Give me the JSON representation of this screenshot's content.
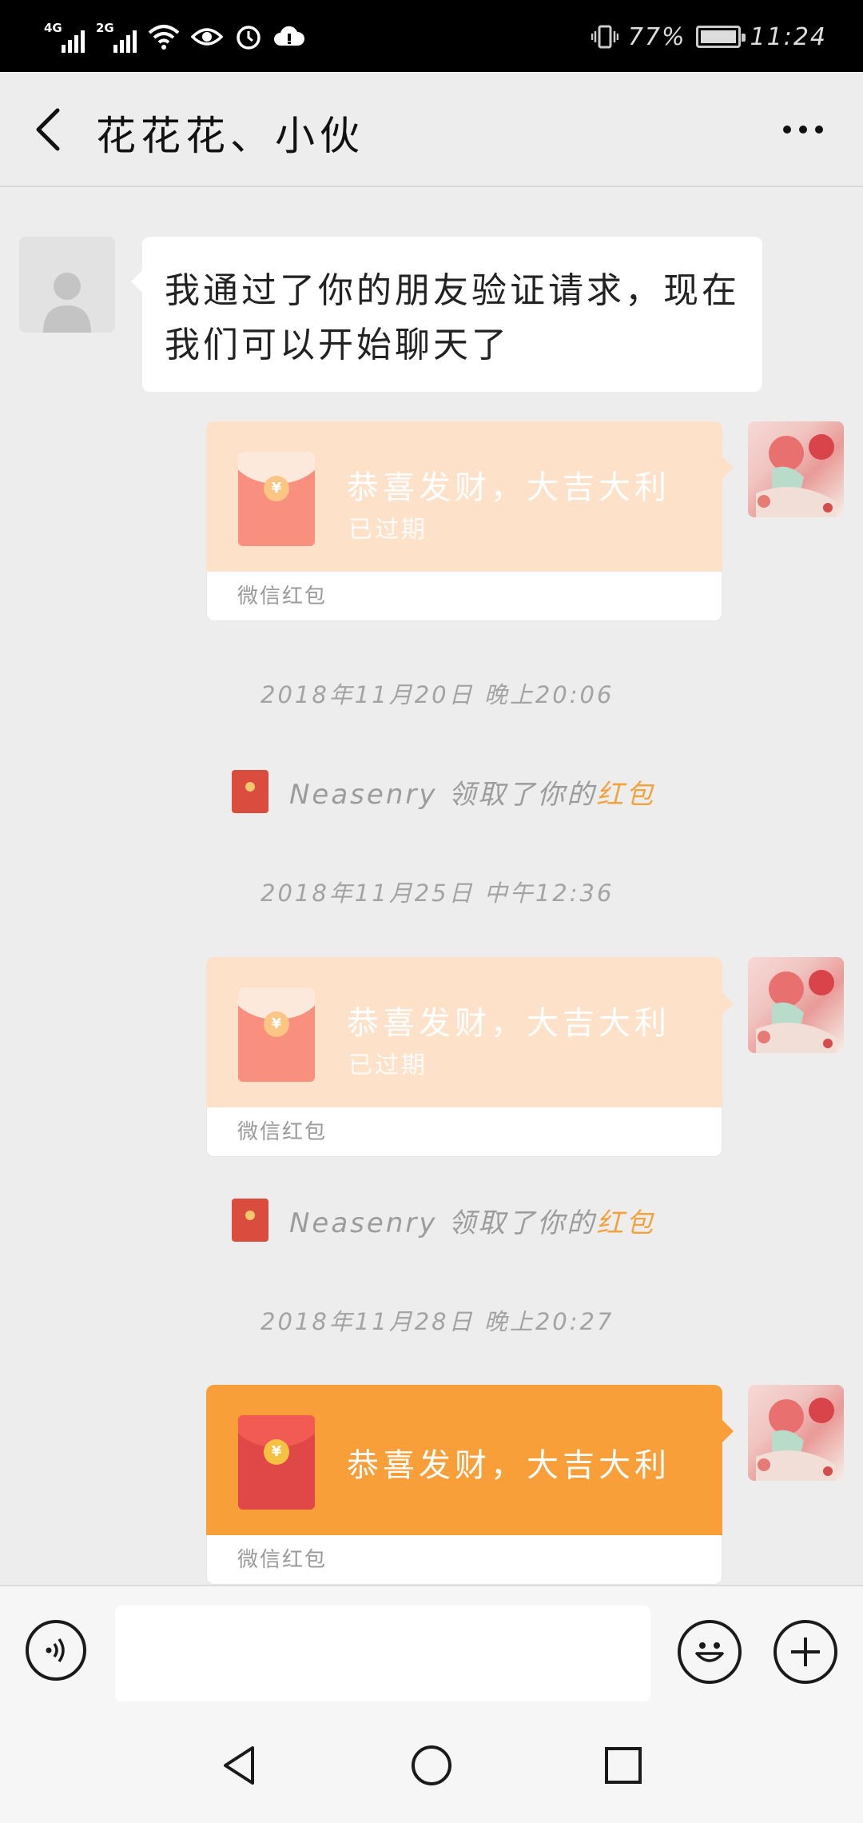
{
  "status_bar": {
    "network_1": "4G",
    "network_2": "2G",
    "battery": "77%",
    "time": "11:24"
  },
  "header": {
    "title": "花花花、小伙",
    "back_icon": "chevron-left-icon",
    "more_icon": "more-horizontal-icon"
  },
  "messages": {
    "friend_text": "我通过了你的朋友验证请求，现在我们可以开始聊天了",
    "red_packets": [
      {
        "title": "恭喜发财，大吉大利",
        "status": "已过期",
        "footer": "微信红包",
        "state": "expired"
      },
      {
        "title": "恭喜发财，大吉大利",
        "status": "已过期",
        "footer": "微信红包",
        "state": "expired"
      },
      {
        "title": "恭喜发财，大吉大利",
        "status": "",
        "footer": "微信红包",
        "state": "active"
      }
    ],
    "timestamps": [
      "2018年11月20日 晚上20:06",
      "2018年11月25日 中午12:36",
      "2018年11月28日 晚上20:27"
    ],
    "system_notes": [
      {
        "prefix": "Neasenry 领取了你的",
        "link": "红包"
      },
      {
        "prefix": "Neasenry 领取了你的",
        "link": "红包"
      }
    ]
  },
  "input_bar": {
    "voice_icon": "voice-icon",
    "emoji_icon": "emoji-icon",
    "plus_icon": "plus-icon",
    "input_value": ""
  },
  "nav_bar": {
    "back_icon": "triangle-back-icon",
    "home_icon": "circle-home-icon",
    "recents_icon": "square-recents-icon"
  },
  "colors": {
    "background": "#ededed",
    "expired_packet": "#fde2c9",
    "active_packet": "#f99f3a",
    "link": "#f3a33e"
  }
}
